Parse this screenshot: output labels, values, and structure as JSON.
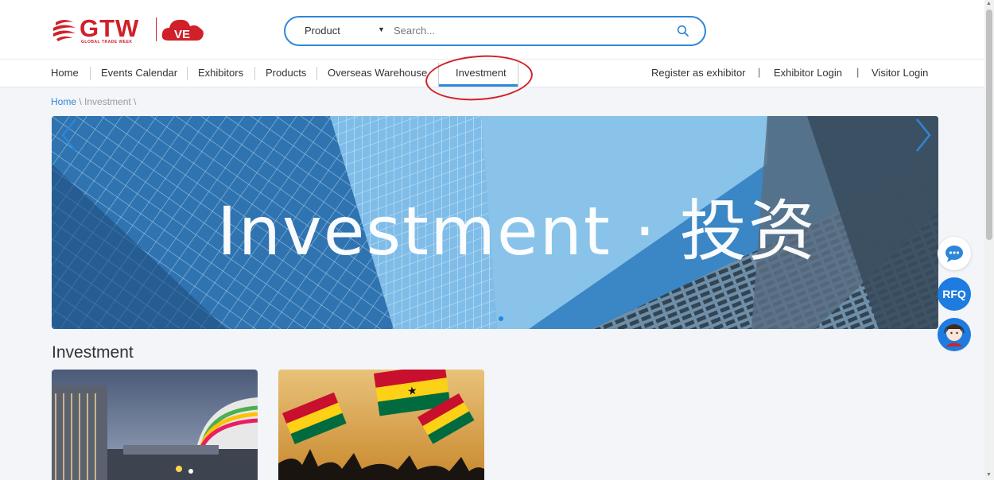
{
  "header": {
    "logo_text": "GTW",
    "logo_subtitle": "GLOBAL TRADE WEEK",
    "logo_badge": "VE",
    "search": {
      "category": "Product",
      "placeholder": "Search..."
    }
  },
  "nav": {
    "items": [
      "Home",
      "Events Calendar",
      "Exhibitors",
      "Products",
      "Overseas Warehouse",
      "Investment"
    ],
    "active": "Investment",
    "right": [
      "Register as exhibitor",
      "Exhibitor Login",
      "Visitor Login"
    ],
    "pipe": "|"
  },
  "breadcrumb": {
    "home": "Home",
    "rest": " \\ Investment \\"
  },
  "banner": {
    "title": "Investment · 投资"
  },
  "section": {
    "title": "Investment"
  },
  "side": {
    "rfq": "RFQ"
  },
  "colors": {
    "accent": "#2d86d9",
    "brand": "#d0202a",
    "fab": "#1e7be0"
  }
}
